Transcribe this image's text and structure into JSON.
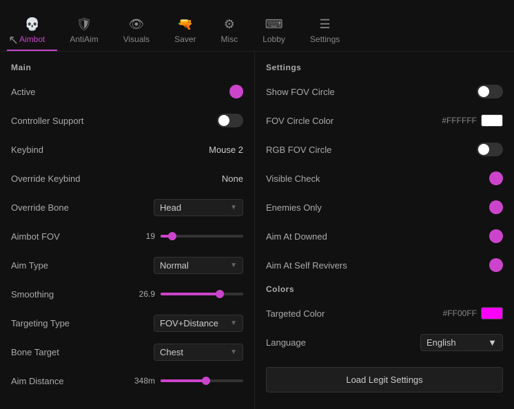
{
  "nav": {
    "items": [
      {
        "id": "aimbot",
        "label": "Aimbot",
        "icon": "💀",
        "active": true
      },
      {
        "id": "antiAim",
        "label": "AntiAim",
        "icon": "🛡️",
        "active": false
      },
      {
        "id": "visuals",
        "label": "Visuals",
        "icon": "👁",
        "active": false
      },
      {
        "id": "saver",
        "label": "Saver",
        "icon": "🔫",
        "active": false
      },
      {
        "id": "misc",
        "label": "Misc",
        "icon": "⚙️",
        "active": false
      },
      {
        "id": "lobby",
        "label": "Lobby",
        "icon": "⌨",
        "active": false
      },
      {
        "id": "settings",
        "label": "Settings",
        "icon": "≡",
        "active": false
      }
    ]
  },
  "left": {
    "section_title": "Main",
    "rows": [
      {
        "label": "Active",
        "type": "toggle_dot",
        "value": "on"
      },
      {
        "label": "Controller Support",
        "type": "toggle",
        "value": "off"
      },
      {
        "label": "Keybind",
        "type": "value",
        "value": "Mouse 2"
      },
      {
        "label": "Override Keybind",
        "type": "value",
        "value": "None"
      },
      {
        "label": "Override Bone",
        "type": "dropdown",
        "value": "Head"
      },
      {
        "label": "Aimbot FOV",
        "type": "slider",
        "numeric": "19",
        "percent": 14
      },
      {
        "label": "Aim Type",
        "type": "dropdown",
        "value": "Normal"
      },
      {
        "label": "Smoothing",
        "type": "slider",
        "numeric": "26.9",
        "percent": 72
      },
      {
        "label": "Targeting Type",
        "type": "dropdown",
        "value": "FOV+Distance"
      },
      {
        "label": "Bone Target",
        "type": "dropdown",
        "value": "Chest"
      },
      {
        "label": "Aim Distance",
        "type": "slider",
        "numeric": "348m",
        "percent": 55
      }
    ]
  },
  "right": {
    "section_title": "Settings",
    "rows": [
      {
        "label": "Show FOV Circle",
        "type": "toggle",
        "value": "off"
      },
      {
        "label": "FOV Circle Color",
        "type": "color",
        "hex": "#FFFFFF",
        "color": "#ffffff"
      },
      {
        "label": "RGB FOV Circle",
        "type": "toggle",
        "value": "off"
      },
      {
        "label": "Visible Check",
        "type": "toggle_dot",
        "value": "on"
      },
      {
        "label": "Enemies Only",
        "type": "toggle_dot",
        "value": "on"
      },
      {
        "label": "Aim At Downed",
        "type": "toggle_dot",
        "value": "on"
      },
      {
        "label": "Aim At Self Revivers",
        "type": "toggle_dot",
        "value": "on"
      }
    ],
    "colors_section": "Colors",
    "colors_rows": [
      {
        "label": "Targeted Color",
        "type": "color",
        "hex": "#FF00FF",
        "color": "#ff00ff"
      }
    ],
    "language_label": "Language",
    "language_value": "English",
    "load_button": "Load Legit Settings"
  }
}
